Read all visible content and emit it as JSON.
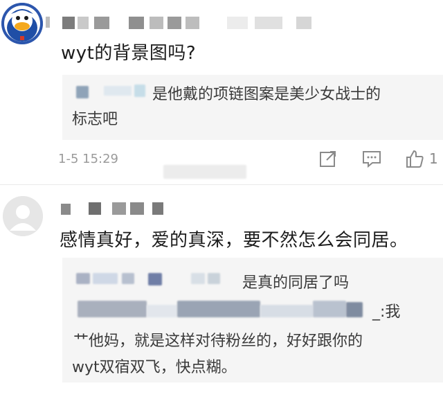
{
  "comments": [
    {
      "text": "wyt的背景图吗?",
      "reply": {
        "line1": "是他戴的项链图案是美少女战士的",
        "line2": "标志吧"
      },
      "timestamp": "1-5 15:29",
      "like_count": "1",
      "icons": {
        "share": "share-icon",
        "comment": "comment-icon",
        "like": "thumbs-up-icon"
      }
    },
    {
      "text": "感情真好，爱的真深，要不然怎么会同居。",
      "reply": {
        "line1": "是真的同居了吗",
        "line2": "_:我",
        "line3": "艹他妈，就是这样对待粉丝的，好好跟你的",
        "line4": "wyt双宿双飞，快点糊。"
      }
    }
  ],
  "colors": {
    "reply_bg": "#f5f5f5",
    "meta_text": "#9a9a9a",
    "text": "#1c1c1c"
  }
}
